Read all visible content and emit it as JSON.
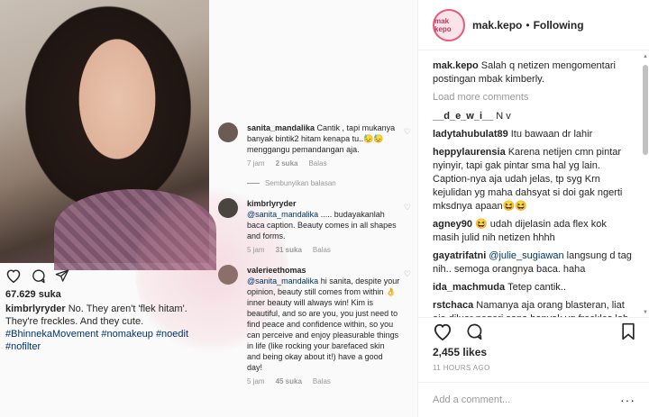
{
  "embedded": {
    "likes": "67.629 suka",
    "caption": {
      "user": "kimbrlyryder",
      "text": " No. They aren't 'flek hitam'. They're freckles. And they cute. ",
      "hashtags": "#BhinnekaMovement #nomakeup #noedit #nofilter"
    },
    "replies": [
      {
        "user": "sanita_mandalika",
        "text": " Cantik , tapi mukanya banyak bintik2 hitam kenapa tu..😓😓 menggangu pemandangan aja.",
        "time": "7 jam",
        "likes": "2 suka",
        "reply": "Balas"
      },
      {
        "user": "kimbrlyryder",
        "mention": "@sanita_mandalika",
        "text": " ..... budayakanlah baca caption. Beauty comes in all shapes and forms.",
        "time": "5 jam",
        "likes": "31 suka",
        "reply": "Balas"
      },
      {
        "user": "valerieethomas",
        "mention": "@sanita_mandalika",
        "text": " hi sanita, despite your opinion, beauty still comes from within 👌 inner beauty will always win! Kim is beautiful, and so are you, you just need to find peace and confidence within, so you can perceive and enjoy pleasurable things in life (like rocking your barefaced skin and being okay about it!) have a good day!",
        "time": "5 jam",
        "likes": "45 suka",
        "reply": "Balas"
      }
    ],
    "hide_replies": "Sembunyikan balasan",
    "watermark": "makepo"
  },
  "post": {
    "username": "mak.kepo",
    "follow_status": "Following",
    "avatar_text": "mak kepo",
    "likes": "2,455 likes",
    "time": "11 HOURS AGO",
    "add_comment_placeholder": "Add a comment...",
    "load_more": "Load more comments",
    "comments": [
      {
        "user": "mak.kepo",
        "text": "Salah q netizen mengomentari postingan mbak kimberly."
      },
      {
        "user": "__d_e_w_i__",
        "text": "N v"
      },
      {
        "user": "ladytahubulat89",
        "text": "Itu bawaan dr lahir"
      },
      {
        "user": "heppylaurensia",
        "text": "Karena netijen cmn pintar nyinyir, tapi gak pintar sma hal yg lain. Caption-nya aja udah jelas, tp syg Krn kejulidan yg maha dahsyat si doi gak ngerti mksdnya apaan😆😆"
      },
      {
        "user": "agney90",
        "text": "😆 udah dijelasin ada flex kok masih julid nih netizen hhhh"
      },
      {
        "user": "gayatrifatni",
        "mention": "@julie_sugiawan",
        "text": " langsung d tag nih.. semoga orangnya baca. haha"
      },
      {
        "user": "ida_machmuda",
        "text": "Tetep cantik.."
      },
      {
        "user": "rstchaca",
        "text": "Namanya aja orang blasteran, liat aja diluar negeri sana banyak yg freckles loh. Mereka malah bangga"
      }
    ]
  },
  "colors": {
    "link": "#003569",
    "muted": "#999999",
    "border": "#efefef",
    "text": "#262626"
  }
}
